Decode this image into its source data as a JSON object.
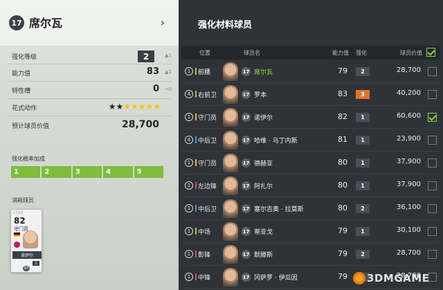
{
  "left": {
    "ovr": "17",
    "player_name": "席尔瓦",
    "chevron": "›",
    "stats": [
      {
        "label": "强化等级",
        "value": "2",
        "delta": "▲1"
      },
      {
        "label": "能力值",
        "value": "83",
        "delta": "▲1"
      },
      {
        "label": "特性槽",
        "value": "0",
        "delta": "→0"
      },
      {
        "label": "花式动作",
        "value": "",
        "delta": ""
      },
      {
        "label": "预计球员价值",
        "value": "28,700",
        "delta": ""
      }
    ],
    "skill_stars": {
      "filled": 2,
      "empty": 5
    },
    "boost_label": "强化概率加成",
    "boost_levels": [
      "1",
      "2",
      "3",
      "4",
      "5"
    ],
    "consumed_label": "消耗球员",
    "consumed_card": {
      "season": "17/18",
      "ovr": "82",
      "position": "守门员",
      "name": "诺伊尔",
      "level": "1",
      "bottom": "83"
    }
  },
  "right": {
    "title": "强化材料球员",
    "headers": {
      "position": "位置",
      "name": "球员名",
      "ovr": "能力值",
      "enhance": "强化",
      "price": "球员价值"
    },
    "rows": [
      {
        "lvl": "1",
        "pos": "前腰",
        "pos_color": "#8fd14f",
        "season": "17",
        "name": "席尔瓦",
        "highlight": true,
        "ovr": "79",
        "enhance": "2",
        "enhance_color": "#4a4f57",
        "price": "28,700",
        "checked": false
      },
      {
        "lvl": "4",
        "pos": "右前卫",
        "pos_color": "#8fd14f",
        "season": "17",
        "name": "罗本",
        "highlight": false,
        "ovr": "83",
        "enhance": "3",
        "enhance_color": "#e0742e",
        "price": "40,200",
        "checked": false
      },
      {
        "lvl": "1",
        "pos": "守门员",
        "pos_color": "#f2b83a",
        "season": "17",
        "name": "诺伊尔",
        "highlight": false,
        "ovr": "82",
        "enhance": "1",
        "enhance_color": "#4a4f57",
        "price": "60,600",
        "checked": true
      },
      {
        "lvl": "4",
        "pos": "中后卫",
        "pos_color": "#3d9ad9",
        "season": "17",
        "name": "哈维 · 马丁内斯",
        "highlight": false,
        "ovr": "81",
        "enhance": "1",
        "enhance_color": "#4a4f57",
        "price": "23,900",
        "checked": false
      },
      {
        "lvl": "1",
        "pos": "守门员",
        "pos_color": "#f2b83a",
        "season": "17",
        "name": "德赫亚",
        "highlight": false,
        "ovr": "80",
        "enhance": "1",
        "enhance_color": "#4a4f57",
        "price": "37,900",
        "checked": false
      },
      {
        "lvl": "1",
        "pos": "左边锋",
        "pos_color": "#e64a4a",
        "season": "17",
        "name": "阿扎尔",
        "highlight": false,
        "ovr": "80",
        "enhance": "1",
        "enhance_color": "#4a4f57",
        "price": "37,900",
        "checked": false
      },
      {
        "lvl": "1",
        "pos": "中后卫",
        "pos_color": "#3d9ad9",
        "season": "17",
        "name": "塞尔吉奥 · 拉莫斯",
        "highlight": false,
        "ovr": "80",
        "enhance": "2",
        "enhance_color": "#4a4f57",
        "price": "36,100",
        "checked": false
      },
      {
        "lvl": "1",
        "pos": "中场",
        "pos_color": "#8fd14f",
        "season": "17",
        "name": "蒂亚戈",
        "highlight": false,
        "ovr": "79",
        "enhance": "1",
        "enhance_color": "#4a4f57",
        "price": "30,100",
        "checked": false
      },
      {
        "lvl": "1",
        "pos": "影锋",
        "pos_color": "#e64a4a",
        "season": "17",
        "name": "默滕斯",
        "highlight": false,
        "ovr": "79",
        "enhance": "2",
        "enhance_color": "#4a4f57",
        "price": "28,700",
        "checked": false
      },
      {
        "lvl": "1",
        "pos": "中锋",
        "pos_color": "#e64a4a",
        "season": "17",
        "name": "冈萨罗 · 伊瓜因",
        "highlight": false,
        "ovr": "79",
        "enhance": "2",
        "enhance_color": "#4a4f57",
        "price": "28,700",
        "checked": false
      }
    ]
  },
  "watermark": "3DMGAME"
}
